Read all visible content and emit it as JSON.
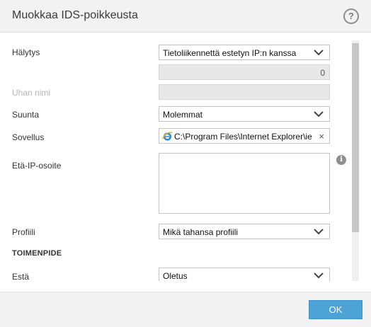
{
  "dialog": {
    "title": "Muokkaa IDS-poikkeusta",
    "help_label": "?"
  },
  "form": {
    "alert": {
      "label": "Hälytys",
      "value": "Tietoliikennettä estetyn IP:n kanssa"
    },
    "alert_count": {
      "value": "0"
    },
    "threat_name": {
      "label": "Uhan nimi",
      "value": ""
    },
    "direction": {
      "label": "Suunta",
      "value": "Molemmat"
    },
    "application": {
      "label": "Sovellus",
      "value": "C:\\Program Files\\Internet Explorer\\ie",
      "icon": "internet-explorer-icon",
      "clear_label": "×"
    },
    "remote_ip": {
      "label": "Etä-IP-osoite",
      "value": "",
      "info_label": "i"
    },
    "profile": {
      "label": "Profiili",
      "value": "Mikä tahansa profiili"
    },
    "action_section": {
      "label": "TOIMENPIDE"
    },
    "block": {
      "label": "Estä",
      "value": "Oletus"
    }
  },
  "footer": {
    "ok_label": "OK"
  },
  "colors": {
    "accent": "#4da3d6",
    "header_bg": "#f2f2f2",
    "disabled_bg": "#e8e8e8"
  }
}
